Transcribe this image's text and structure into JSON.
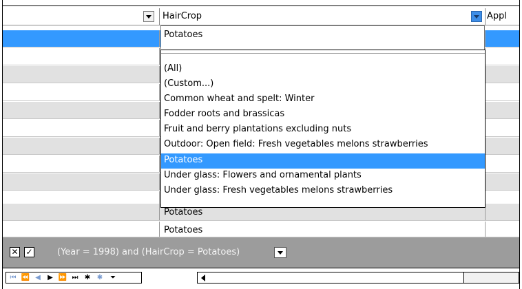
{
  "header": {
    "col_hair_crop": "HairCrop",
    "col_next": "Appl"
  },
  "editor_value": "Potatoes",
  "dropdown": {
    "options": [
      "(All)",
      "(Custom...)",
      "Common wheat and spelt: Winter",
      "Fodder roots and brassicas",
      "Fruit and berry plantations excluding nuts",
      "Outdoor: Open field: Fresh vegetables  melons  strawberries",
      "Potatoes",
      "Under glass: Flowers and ornamental plants",
      "Under glass: Fresh vegetables  melons  strawberries"
    ],
    "selected": "Potatoes"
  },
  "rows": {
    "below_cell_1": "Potatoes",
    "below_cell_2": "Potatoes"
  },
  "filter": {
    "remove_symbol": "✕",
    "enabled_symbol": "✓",
    "expression": "(Year = 1998) and (HairCrop = Potatoes)"
  },
  "navigator": {
    "buttons": [
      "⏮",
      "⏪",
      "◀",
      "▶",
      "⏩",
      "⏭",
      "✱",
      "✱",
      "⏷"
    ]
  },
  "colors": {
    "selection": "#3399ff",
    "alt_row": "#e1e1e1",
    "filter_bar": "#9c9c9c"
  }
}
